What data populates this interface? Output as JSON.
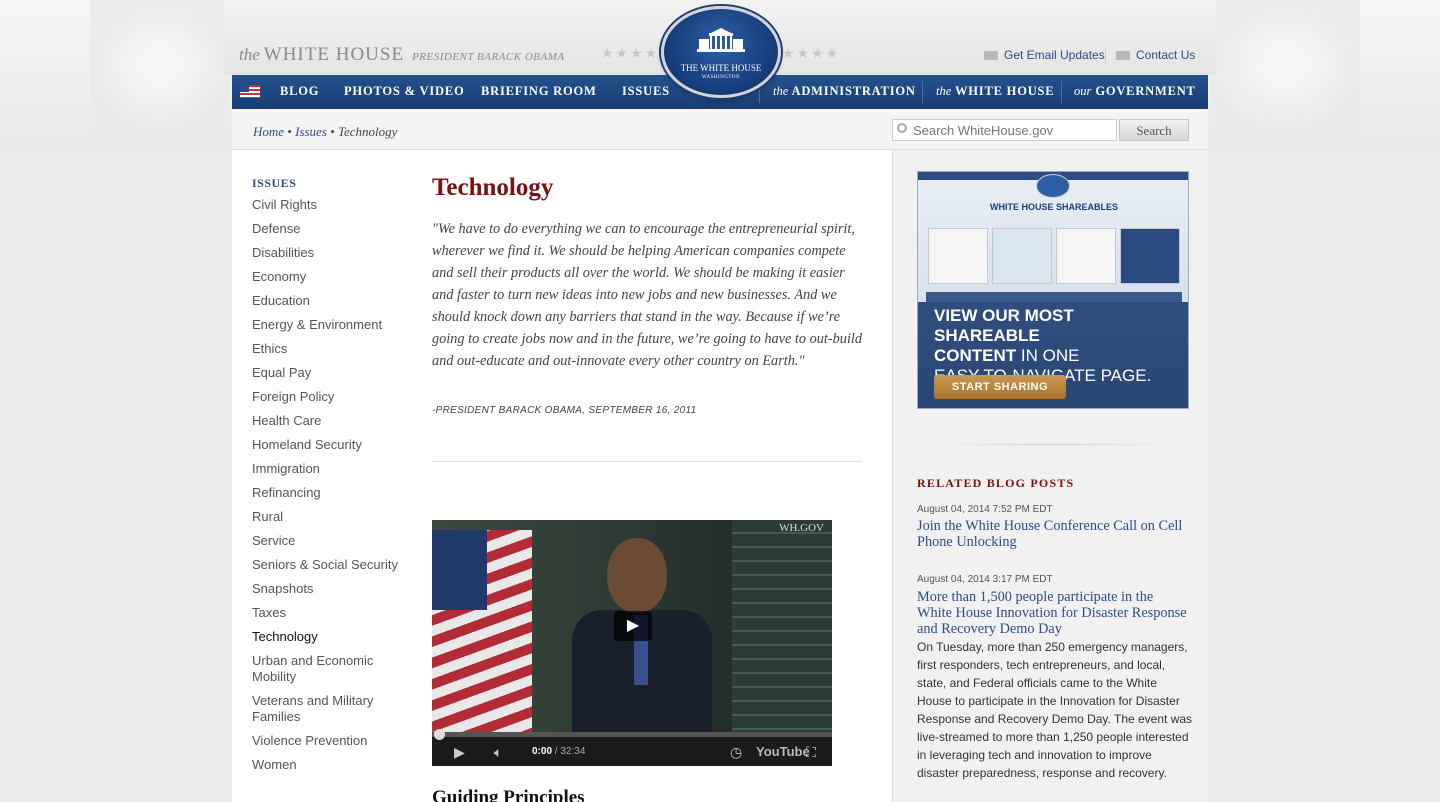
{
  "brand": {
    "the": "the",
    "name": "WHITE HOUSE",
    "subtitle": "PRESIDENT BARACK OBAMA"
  },
  "seal": {
    "line1": "THE WHITE HOUSE",
    "line2": "WASHINGTON"
  },
  "utility": {
    "email": "Get Email Updates",
    "contact": "Contact Us"
  },
  "nav": {
    "left": [
      "BLOG",
      "PHOTOS & VIDEO",
      "BRIEFING ROOM",
      "ISSUES"
    ],
    "admin_the": "the",
    "admin": "ADMINISTRATION",
    "wh_the": "the",
    "wh": "WHITE HOUSE",
    "gov_our": "our",
    "gov": "GOVERNMENT"
  },
  "breadcrumb": {
    "home": "Home",
    "issues": "Issues",
    "current": "Technology",
    "sep": "•"
  },
  "search": {
    "placeholder": "Search WhiteHouse.gov",
    "button": "Search"
  },
  "sidebar": {
    "heading": "ISSUES",
    "items": [
      "Civil Rights",
      "Defense",
      "Disabilities",
      "Economy",
      "Education",
      "Energy & Environment",
      "Ethics",
      "Equal Pay",
      "Foreign Policy",
      "Health Care",
      "Homeland Security",
      "Immigration",
      "Refinancing",
      "Rural",
      "Service",
      "Seniors & Social Security",
      "Snapshots",
      "Taxes",
      "Technology",
      "Urban and Economic Mobility",
      "Veterans and Military Families",
      "Violence Prevention",
      "Women"
    ],
    "active": "Technology"
  },
  "main": {
    "title": "Technology",
    "quote": "\"We have to do everything we can to encourage the entrepreneurial spirit, wherever we find it. We should be helping American companies compete and sell their products all over the world. We should be making it easier and faster to turn new ideas into new jobs and new businesses. And we should knock down any barriers that stand in the way. Because if we’re going to create jobs now and in the future, we’re going to have to out-build and out-educate and out-innovate every other country on Earth.\"",
    "attribution": "-PRESIDENT BARACK OBAMA, SEPTEMBER 16, 2011",
    "video": {
      "watermark": "WH.GOV",
      "time_current": "0:00",
      "time_total": "/ 32:34",
      "youtube": "YouTube"
    },
    "section_heading": "Guiding Principles"
  },
  "promo": {
    "title": "WHITE HOUSE SHAREABLES",
    "headline_bold1": "VIEW OUR MOST SHAREABLE",
    "headline_bold2": "CONTENT",
    "headline_rest1": " IN ONE",
    "headline_rest2": "EASY-TO-NAVIGATE PAGE.",
    "button": "START SHARING"
  },
  "related": {
    "heading": "RELATED BLOG POSTS",
    "posts": [
      {
        "date": "August 04, 2014 7:52 PM EDT",
        "title": "Join the White House Conference Call on Cell Phone Unlocking"
      },
      {
        "date": "August 04, 2014 3:17 PM EDT",
        "title": "More than 1,500 people participate in the White House Innovation for Disaster Response and Recovery Demo Day",
        "body": "On Tuesday, more than 250 emergency managers, first responders, tech entrepreneurs, and local, state, and Federal officials came to the White House to participate in the Innovation for Disaster Response and Recovery Demo Day. The event was live-streamed to more than 1,250 people interested in leveraging tech and innovation to improve disaster preparedness, response and recovery."
      }
    ]
  }
}
